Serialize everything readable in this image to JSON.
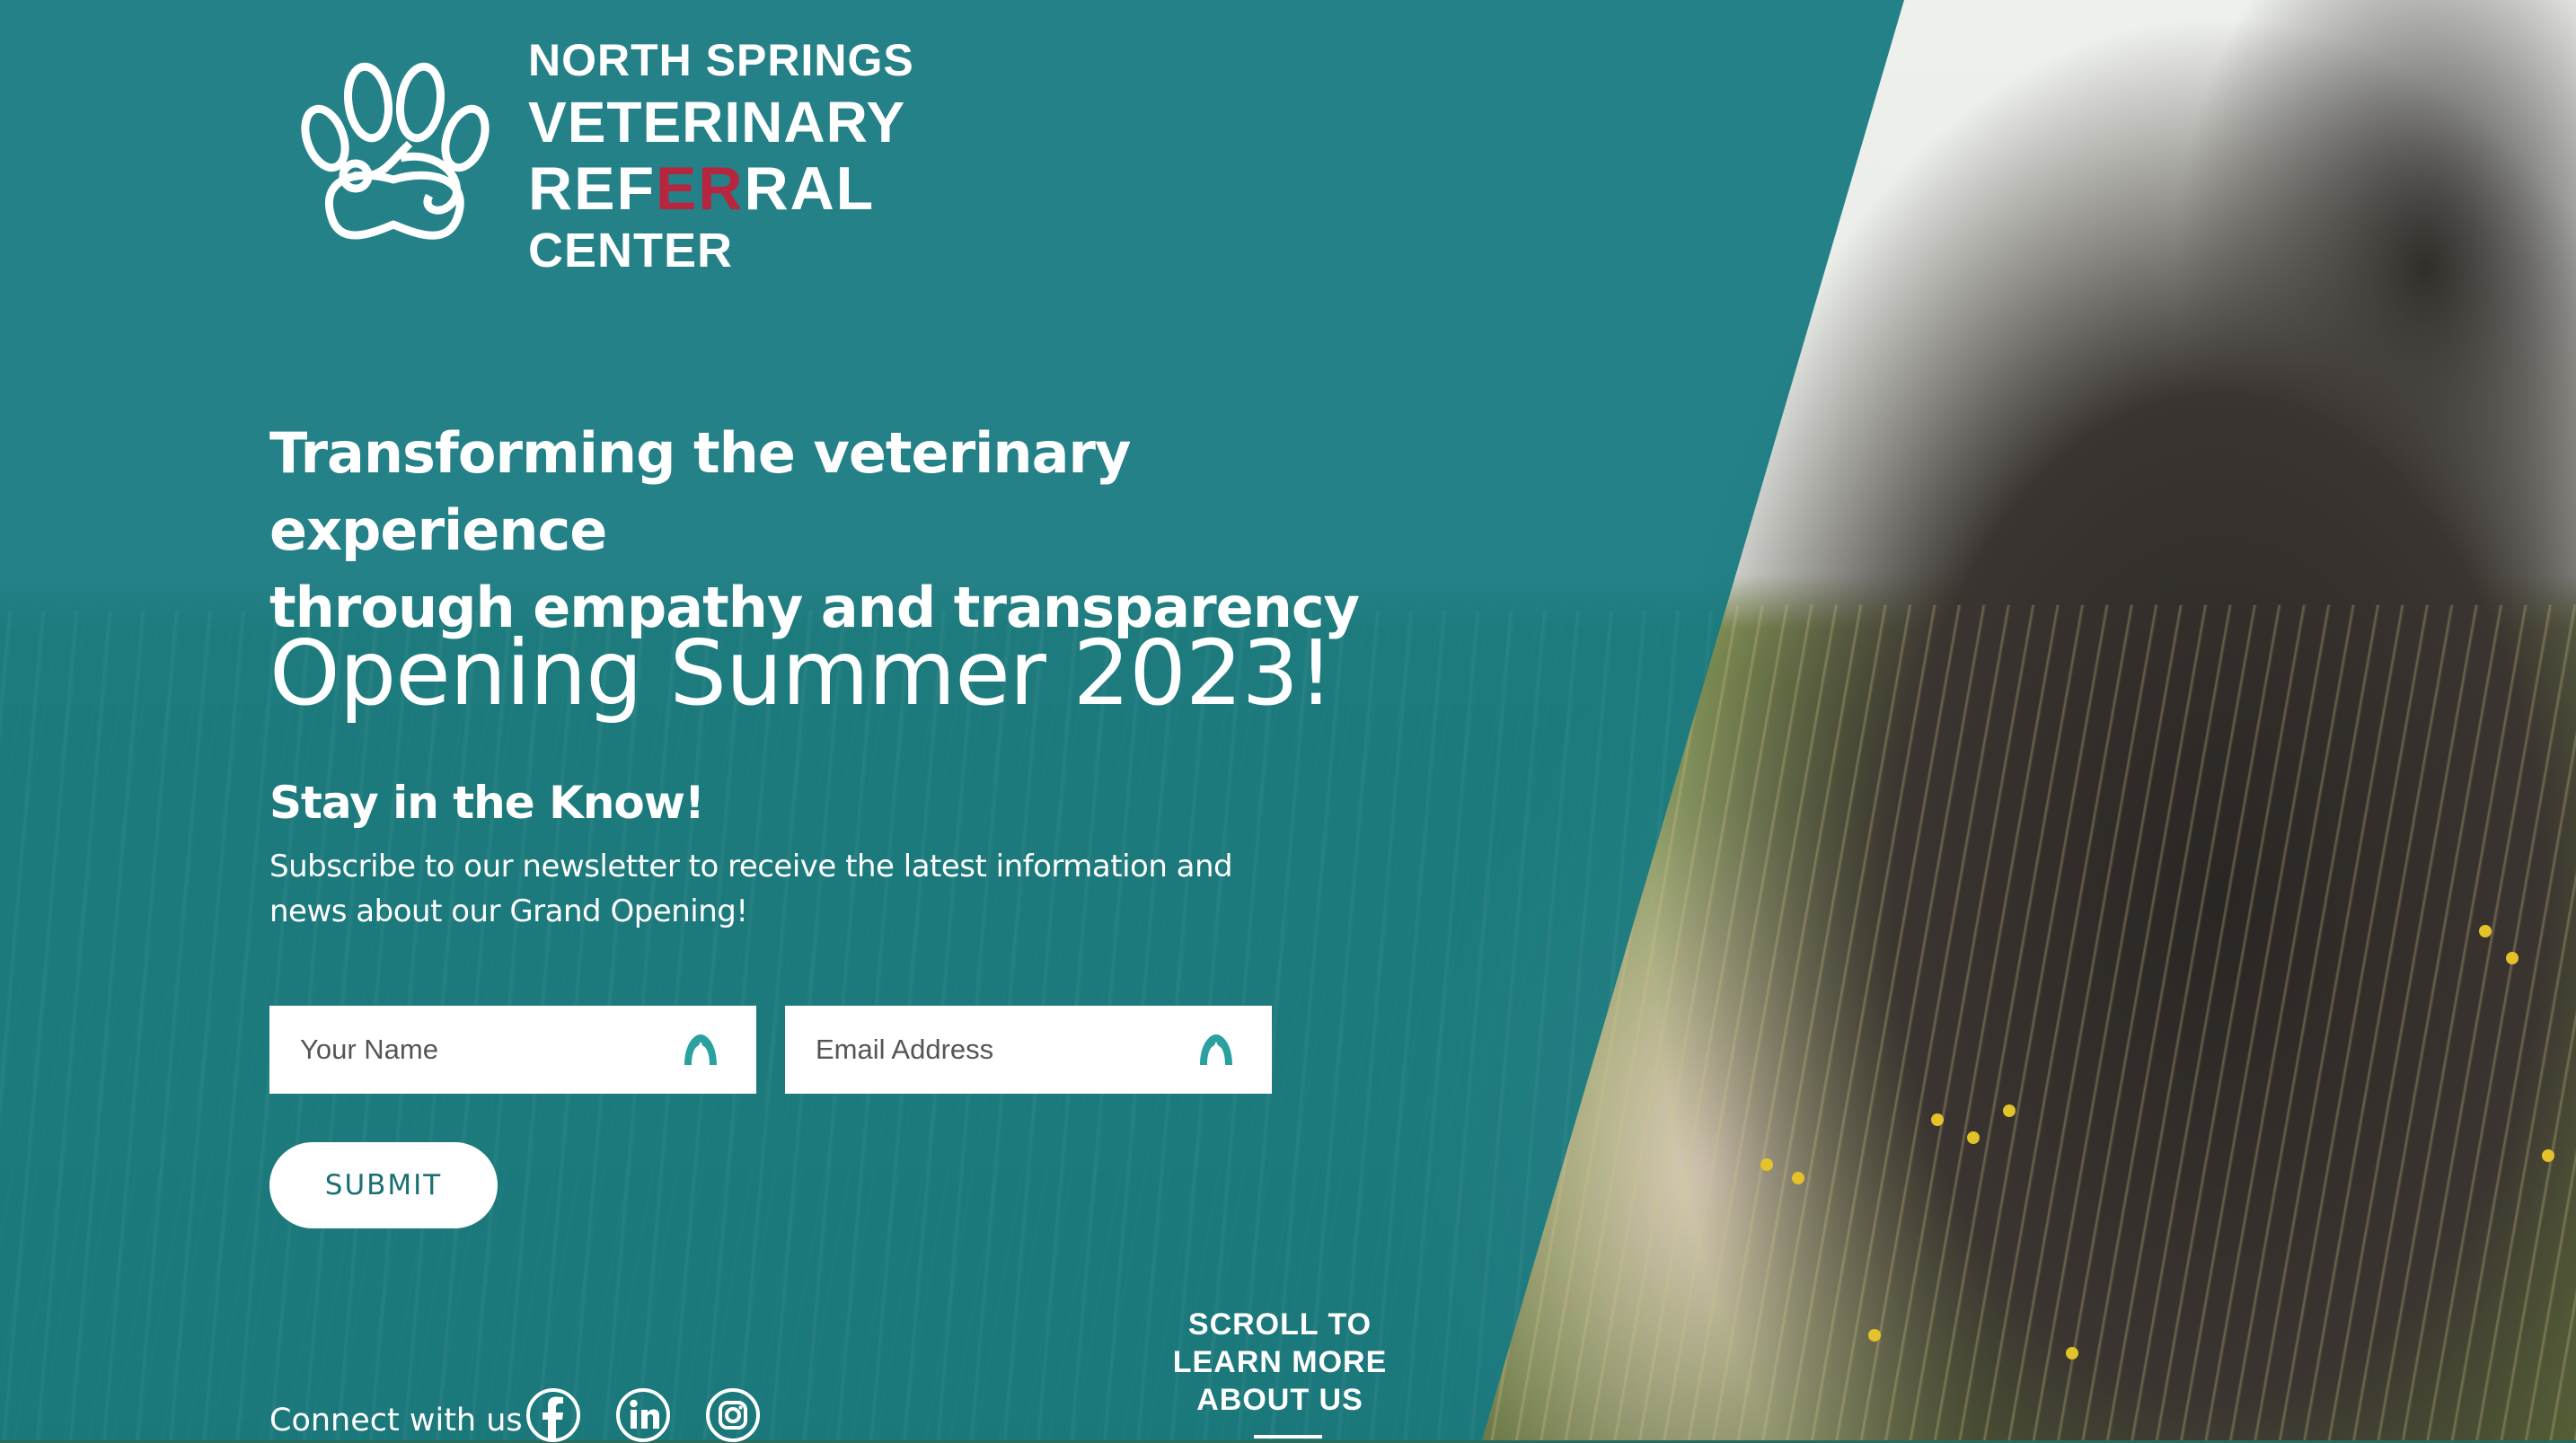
{
  "brand": {
    "line1": "NORTH SPRINGS",
    "line2": "VETERINARY",
    "line3_a": "REF",
    "line3_b": "ER",
    "line3_c": "RAL",
    "line4": "CENTER",
    "accent_color": "#b8253f"
  },
  "hero": {
    "tagline_line1": "Transforming the veterinary experience",
    "tagline_line2": "through empathy and transparency",
    "opening": "Opening Summer 2023!"
  },
  "newsletter": {
    "heading": "Stay in the Know!",
    "description_line1": "Subscribe to our newsletter to receive the latest information and",
    "description_line2": "news about our Grand Opening!",
    "name_placeholder": "Your Name",
    "email_placeholder": "Email Address",
    "submit_label": "SUBMIT"
  },
  "footer": {
    "connect_label": "Connect with us",
    "social": [
      "facebook-icon",
      "linkedin-icon",
      "instagram-icon"
    ]
  },
  "scroll": {
    "line1": "SCROLL TO",
    "line2": "LEARN MORE",
    "line3": "ABOUT US"
  },
  "colors": {
    "teal_overlay": "#167980",
    "button_text": "#1a6f73",
    "white": "#ffffff"
  }
}
